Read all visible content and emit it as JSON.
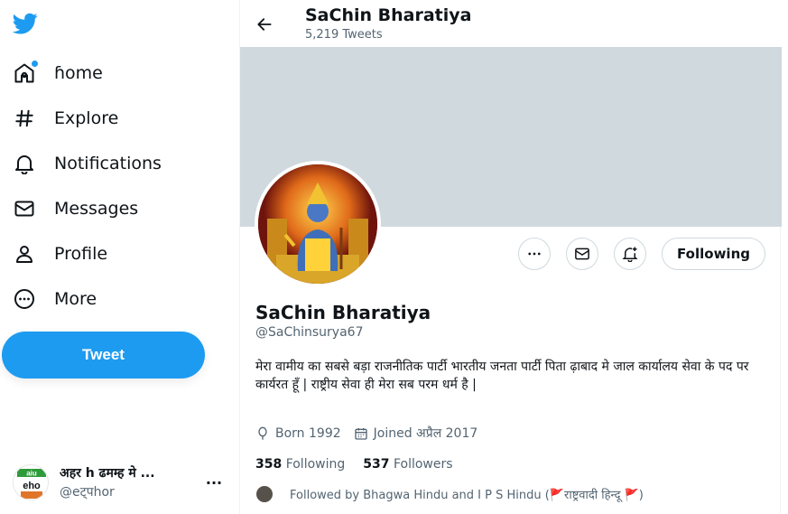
{
  "sidebar": {
    "items": [
      {
        "label": "ɦome",
        "icon": "home-icon"
      },
      {
        "label": "Explore",
        "icon": "hashtag-icon"
      },
      {
        "label": "Notifications",
        "icon": "bell-icon"
      },
      {
        "label": "Messages",
        "icon": "mail-icon"
      },
      {
        "label": "Profile",
        "icon": "person-icon"
      },
      {
        "label": "More",
        "icon": "more-circle-icon"
      }
    ],
    "tweet_label": "Tweet",
    "account": {
      "name": "अहर h ढमम्ह मे ...",
      "handle": "@eट्पhor",
      "more": "···",
      "avatar_text": [
        "aiu",
        "eho"
      ]
    }
  },
  "header": {
    "title": "SaChin Bharatiya",
    "subtitle": "5,219 Tweets"
  },
  "profile": {
    "name": "SaChin Bharatiya",
    "handle": "@SaChinsurya67",
    "bio": "मेरा वामीय का सबसे बड़ा राजनीतिक पार्टी भारतीय जनता पार्टी पिता ढ़ाबाद मे जाल कार्यालय सेवा के पद पर कार्यरत हूँ | राष्ट्रीय सेवा ही मेरा सब परम धर्म है |",
    "born": "Born 1992",
    "joined": "Joined अप्रैल 2017",
    "following_count": "358",
    "following_label": "Following",
    "followers_count": "537",
    "followers_label": "Followers",
    "followed_by": "Followed by Bhagwa Hindu and I P S Hindu (🚩राष्ट्रवादी हिन्दू 🚩)",
    "follow_button": "Following"
  },
  "colors": {
    "accent": "#1d9bf0",
    "banner": "#cfd9de",
    "secondary_text": "#536471"
  }
}
